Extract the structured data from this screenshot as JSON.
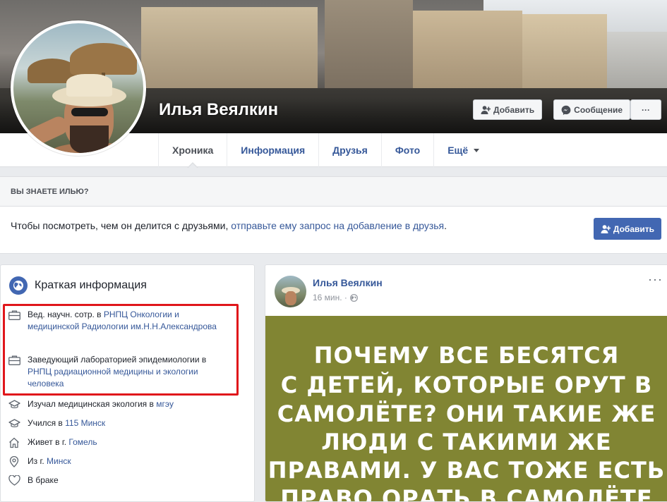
{
  "profile": {
    "name": "Илья Веялкин",
    "add_friend_label": "Добавить",
    "message_label": "Сообщение",
    "more_label": "···"
  },
  "nav": {
    "tabs": [
      {
        "label": "Хроника"
      },
      {
        "label": "Информация"
      },
      {
        "label": "Друзья"
      },
      {
        "label": "Фото"
      },
      {
        "label": "Ещё"
      }
    ]
  },
  "know": {
    "header": "ВЫ ЗНАЕТЕ ИЛЬЮ?",
    "text": "Чтобы посмотреть, чем он делится с друзьями, ",
    "link": "отправьте ему запрос на добавление в друзья",
    "text_end": ".",
    "button": "Добавить"
  },
  "intro": {
    "title": "Краткая информация",
    "work1": {
      "pre": "Вед. научн. сотр. в ",
      "link": "РНПЦ Онкологии и медицинской Радиологии им.Н.Н.Александрова"
    },
    "work2": {
      "pre": "Заведующий лабораторией эпидемиологии в ",
      "link": "РНПЦ радиационной медицины и экологии человека"
    },
    "study1": {
      "pre": "Изучал медицинская экология в ",
      "link": "мгэу"
    },
    "study2": {
      "pre": "Учился в ",
      "link": "115 Минск"
    },
    "lives": {
      "pre": "Живет в г. ",
      "link": "Гомель"
    },
    "from": {
      "pre": "Из г. ",
      "link": "Минск"
    },
    "relationship": "В браке"
  },
  "post": {
    "author": "Илья Веялкин",
    "time": "16 мин. ·",
    "more": "···",
    "image_text": [
      "ПОЧЕМУ ВСЕ БЕСЯТСЯ",
      "С ДЕТЕЙ, КОТОРЫЕ ОРУТ В",
      "САМОЛЁТЕ? ОНИ ТАКИЕ ЖЕ",
      "ЛЮДИ С ТАКИМИ ЖЕ",
      "ПРАВАМИ. У ВАС ТОЖЕ ЕСТЬ",
      "ПРАВО ОРАТЬ В САМОЛЁТЕ"
    ]
  },
  "colors": {
    "link": "#365899",
    "primary_button": "#4267b2",
    "highlight": "#e0161b",
    "post_image_bg": "#818533"
  }
}
